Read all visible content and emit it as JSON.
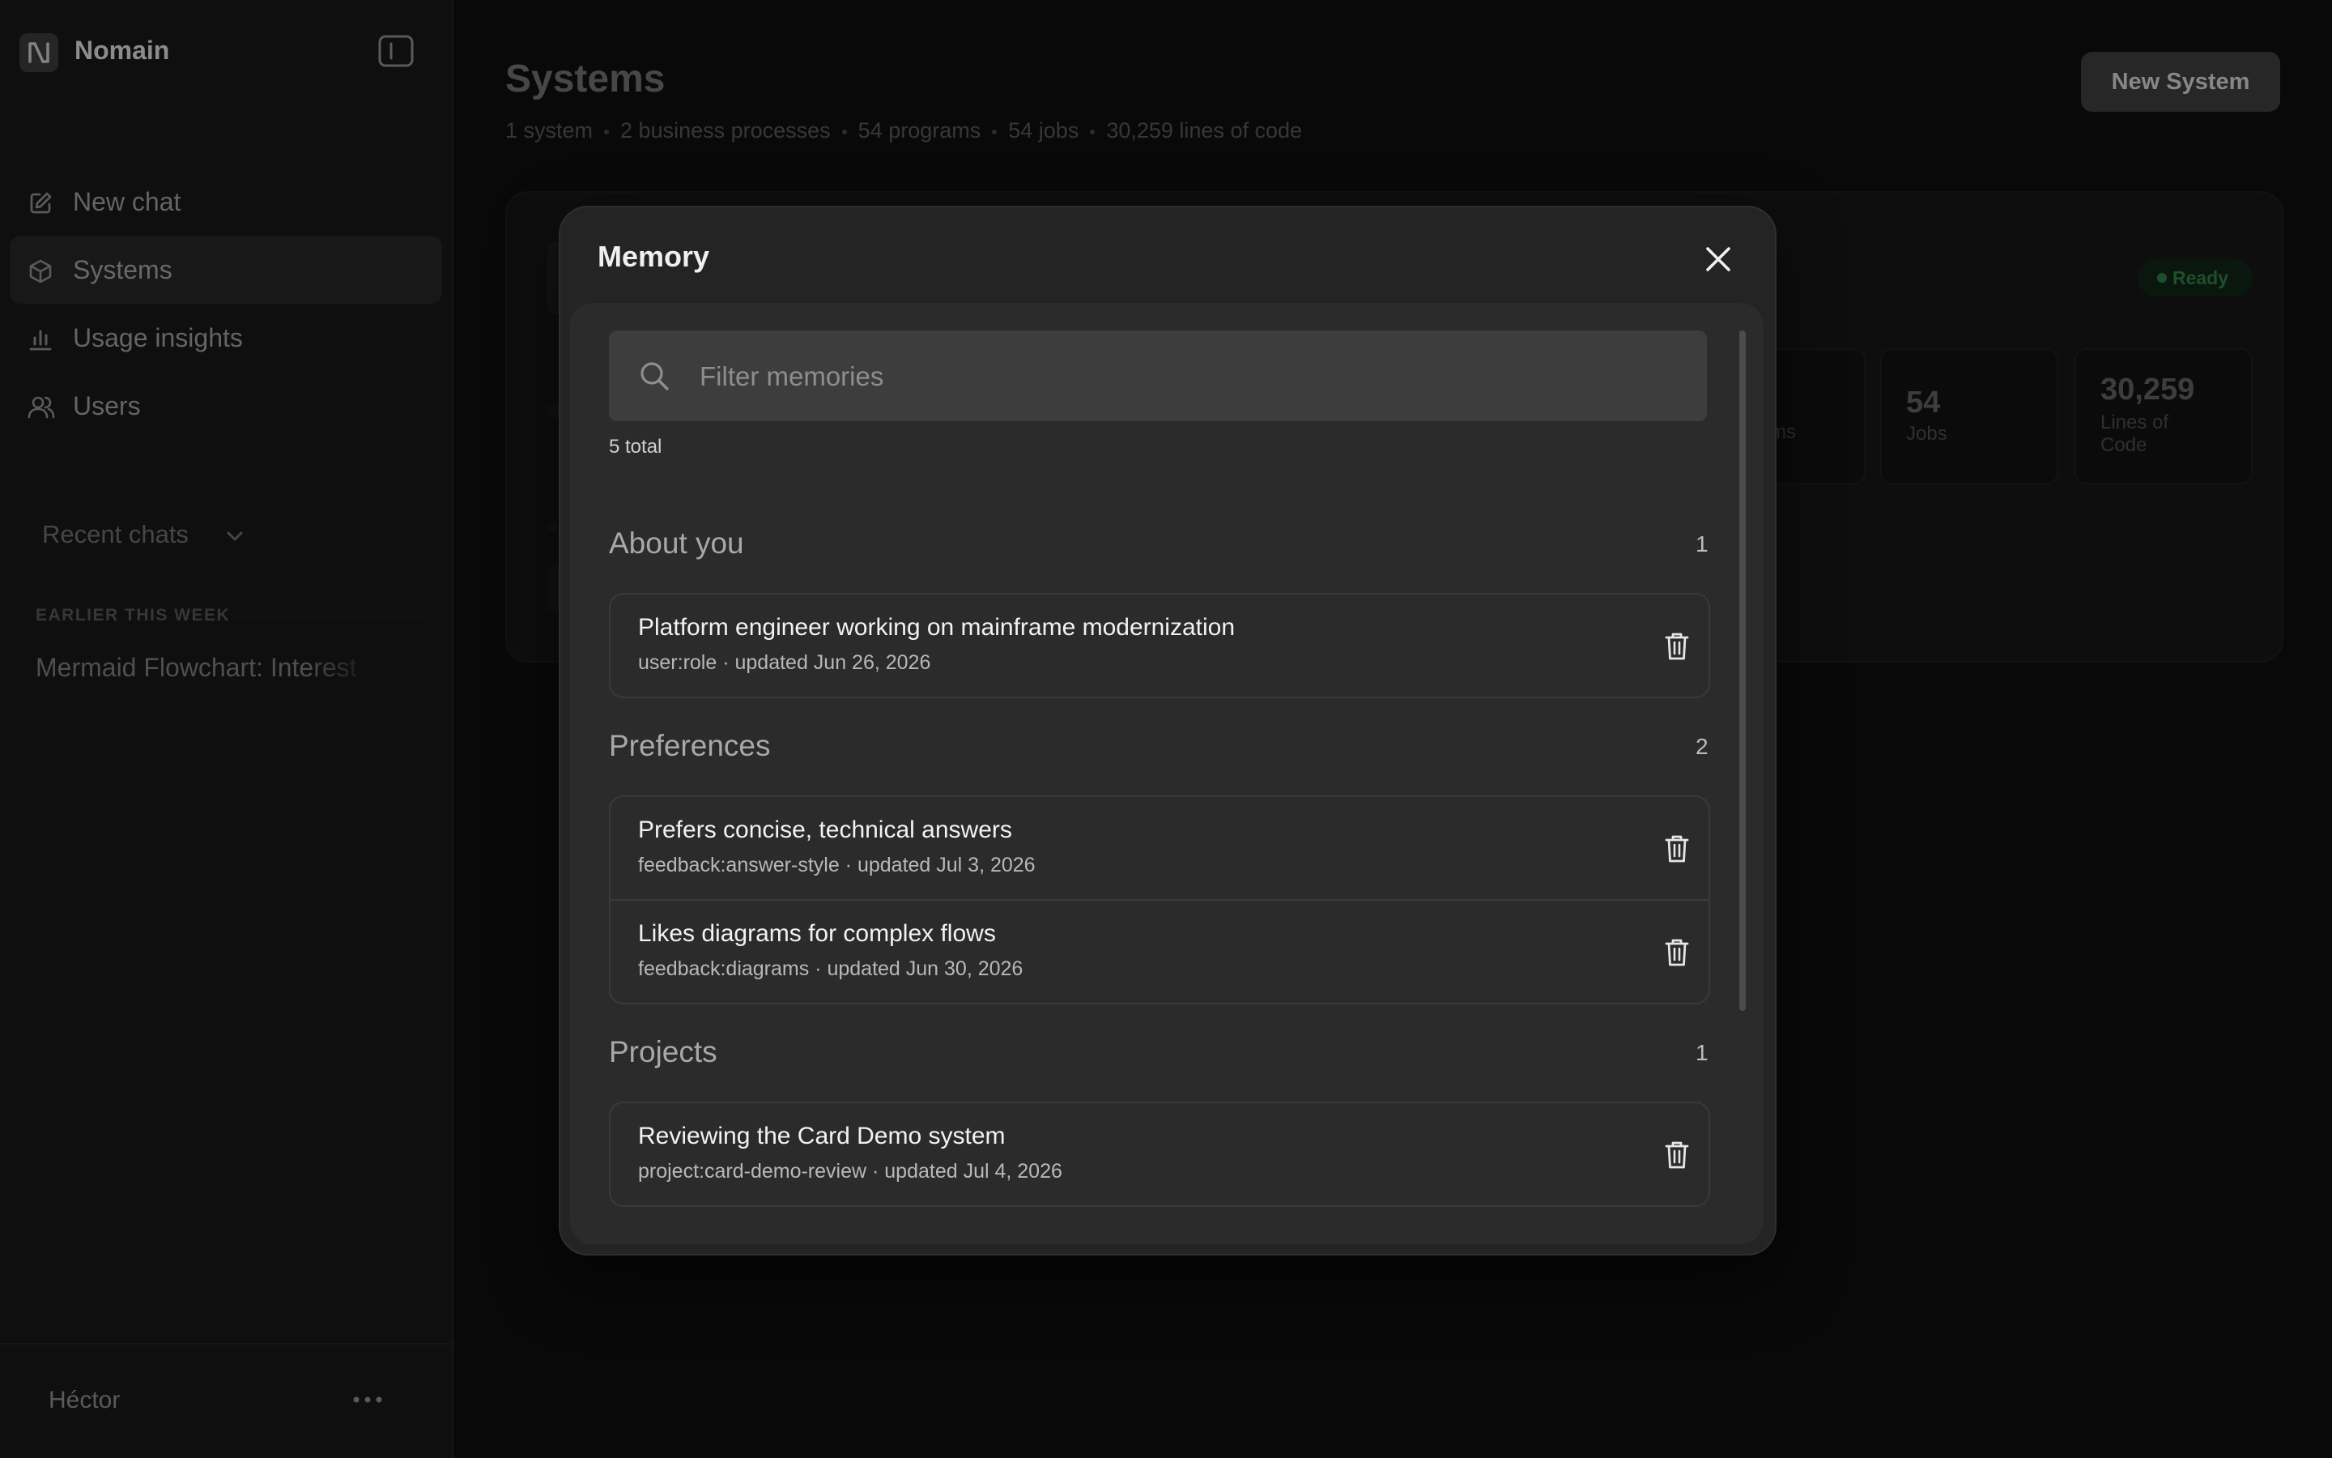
{
  "sidebar": {
    "brand": "Nomain",
    "nav": [
      {
        "label": "New chat",
        "icon": "edit-icon"
      },
      {
        "label": "Systems",
        "icon": "cube-icon",
        "active": true
      },
      {
        "label": "Usage insights",
        "icon": "bar-chart-icon"
      },
      {
        "label": "Users",
        "icon": "users-icon"
      }
    ],
    "recent_label": "Recent chats",
    "section_label": "EARLIER THIS WEEK",
    "chats": [
      "Mermaid Flowchart: Interest Calculation"
    ],
    "user": "Héctor"
  },
  "main": {
    "title": "Systems",
    "stats": [
      "1 system",
      "2 business processes",
      "54 programs",
      "54 jobs",
      "30,259 lines of code"
    ],
    "new_button": "New System",
    "card": {
      "status": "Ready",
      "status_color": "#2f7a44",
      "metrics": [
        {
          "value": "",
          "label": "ms"
        },
        {
          "value": "54",
          "label": "Jobs"
        },
        {
          "value": "30,259",
          "label": "Lines of Code"
        }
      ]
    }
  },
  "modal": {
    "title": "Memory",
    "filter_placeholder": "Filter memories",
    "total": "5 total",
    "groups": [
      {
        "title": "About you",
        "count": "1",
        "items": [
          {
            "title": "Platform engineer working on mainframe modernization",
            "meta": "user:role · updated Jun 26, 2026"
          }
        ]
      },
      {
        "title": "Preferences",
        "count": "2",
        "items": [
          {
            "title": "Prefers concise, technical answers",
            "meta": "feedback:answer-style · updated Jul 3, 2026"
          },
          {
            "title": "Likes diagrams for complex flows",
            "meta": "feedback:diagrams · updated Jun 30, 2026"
          }
        ]
      },
      {
        "title": "Projects",
        "count": "1",
        "items": [
          {
            "title": "Reviewing the Card Demo system",
            "meta": "project:card-demo-review · updated Jul 4, 2026"
          }
        ]
      }
    ]
  }
}
